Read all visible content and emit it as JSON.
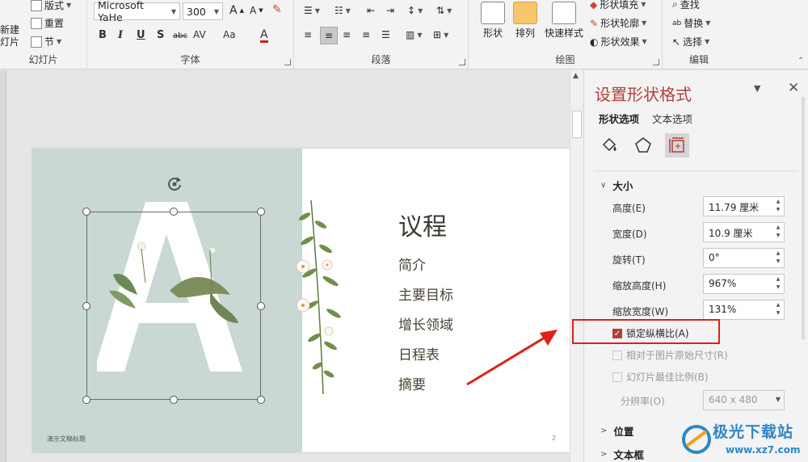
{
  "ribbon": {
    "slides": {
      "new_slide": "新建\n幻灯片",
      "new_slide_line1": "新建",
      "new_slide_line2": "灯片",
      "layout": "版式",
      "reset": "重置",
      "section": "节",
      "label": "幻灯片"
    },
    "font": {
      "font_name": "Microsoft YaHe",
      "font_size": "300",
      "label": "字体",
      "bold": "B",
      "italic": "I",
      "underline": "U",
      "shadow": "S",
      "strike": "abc",
      "spacing": "AV",
      "case": "Aa",
      "color": "A"
    },
    "paragraph": {
      "label": "段落"
    },
    "drawing": {
      "label": "绘图",
      "shapes": "形状",
      "arrange": "排列",
      "quick_styles": "快速样式",
      "shape_fill": "形状填充",
      "shape_outline": "形状轮廓",
      "shape_effects": "形状效果"
    },
    "editing": {
      "label": "编辑",
      "find": "查找",
      "replace": "替换",
      "select": "选择"
    }
  },
  "slide": {
    "title": "议程",
    "agenda_items": [
      "简介",
      "主要目标",
      "增长领域",
      "日程表",
      "摘要"
    ],
    "footer": "演示文稿标题",
    "page_number": "2",
    "accent_color": "#c9d8d3"
  },
  "pane": {
    "title": "设置形状格式",
    "tabs": [
      "形状选项",
      "文本选项"
    ],
    "active_tab": "形状选项",
    "icons": [
      "fill-line-icon",
      "effects-icon",
      "size-properties-icon"
    ],
    "size_section": "大小",
    "fields": [
      {
        "label": "高度(E)",
        "value": "11.79 厘米"
      },
      {
        "label": "宽度(D)",
        "value": "10.9 厘米"
      },
      {
        "label": "旋转(T)",
        "value": "0°"
      },
      {
        "label": "缩放高度(H)",
        "value": "967%"
      },
      {
        "label": "缩放宽度(W)",
        "value": "131%"
      }
    ],
    "lock_aspect": "锁定纵横比(A)",
    "lock_aspect_checked": true,
    "relative_original": "相对于图片原始尺寸(R)",
    "best_scale": "幻灯片最佳比例(B)",
    "resolution_label": "分辨率(O)",
    "resolution_value": "640 x 480",
    "position_section": "位置",
    "textbox_section": "文本框",
    "accent_color": "#b1403a"
  },
  "watermark": {
    "name": "极光下载站",
    "url": "www.xz7.com"
  }
}
